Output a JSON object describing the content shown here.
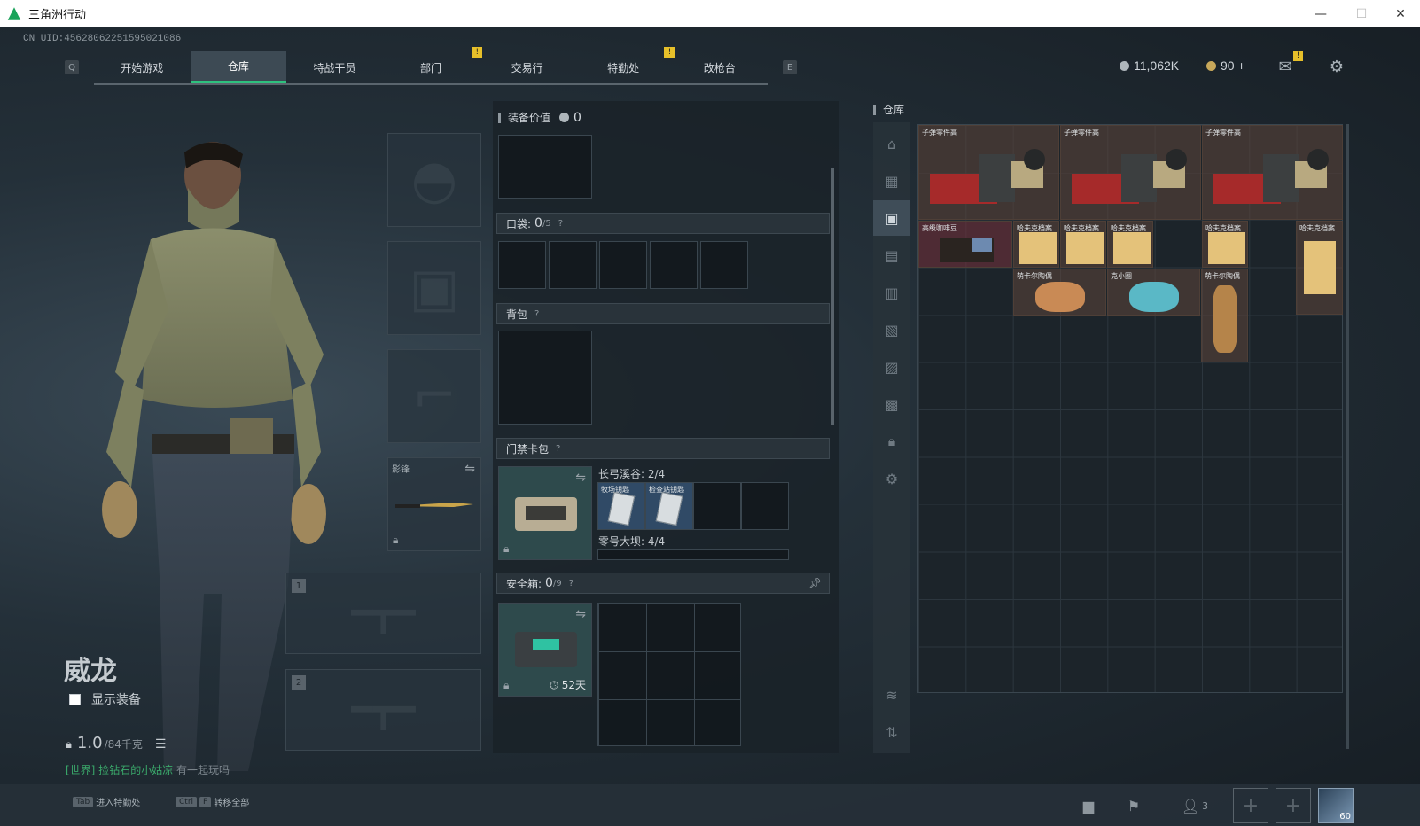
{
  "window": {
    "title": "三角洲行动",
    "min": "—",
    "max": "☐",
    "close": "✕"
  },
  "uid": "CN UID:4562806225159502108​6",
  "nav": {
    "q_key": "Q",
    "e_key": "E",
    "tabs": [
      {
        "label": "开始游戏",
        "badge": ""
      },
      {
        "label": "仓库",
        "badge": ""
      },
      {
        "label": "特战干员",
        "badge": ""
      },
      {
        "label": "部门",
        "badge": "!"
      },
      {
        "label": "交易行",
        "badge": ""
      },
      {
        "label": "特勤处",
        "badge": "!"
      },
      {
        "label": "改枪台",
        "badge": ""
      }
    ]
  },
  "currency": {
    "primary": "11,062K",
    "secondary": "90 +",
    "primary_color": "#aeb6bb",
    "secondary_color": "#c8a85a"
  },
  "mail_badge": "!",
  "character": {
    "name": "威龙",
    "show_gear": "显示装备",
    "weight_value": "1.0",
    "weight_unit": "/84千克"
  },
  "chat": {
    "channel": "[世界]",
    "user": "捡钻石的小姑凉",
    "msg": "有一起玩吗"
  },
  "equipment": {
    "melee_label": "影锋",
    "weapon1_num": "1",
    "weapon2_num": "2"
  },
  "loadout": {
    "value_label": "装备价值",
    "value": "0",
    "pocket_label": "口袋:",
    "pocket_used": "0",
    "pocket_cap": "/5",
    "backpack_label": "背包",
    "keycard_label": "门禁卡包",
    "keycard_map1": "长弓溪谷: 2/4",
    "keycard_map2": "零号大坝: 4/4",
    "key1": "牧场钥匙",
    "key2": "检查站钥匙",
    "safebox_label": "安全箱:",
    "safebox_used": "0",
    "safebox_cap": "/9",
    "safebox_days": "52天",
    "help": "?"
  },
  "stash": {
    "title": "仓库",
    "items": [
      {
        "label": "子弹零件高"
      },
      {
        "label": "子弹零件高"
      },
      {
        "label": "子弹零件高"
      },
      {
        "label": "高级咖啡豆"
      },
      {
        "label": "哈夫克档案"
      },
      {
        "label": "哈夫克档案"
      },
      {
        "label": "哈夫克档案"
      },
      {
        "label": "哈夫克档案"
      },
      {
        "label": "哈夫克档案"
      },
      {
        "label": "萌卡尔陶偶"
      },
      {
        "label": "克小圈"
      },
      {
        "label": "萌卡尔陶偶"
      }
    ]
  },
  "bottom": {
    "hint1_key": "Tab",
    "hint1_text": "进入特勤处",
    "hint2_key1": "Ctrl",
    "hint2_key2": "F",
    "hint2_text": "转移全部",
    "team_count": "3",
    "avatar_level": "60"
  }
}
